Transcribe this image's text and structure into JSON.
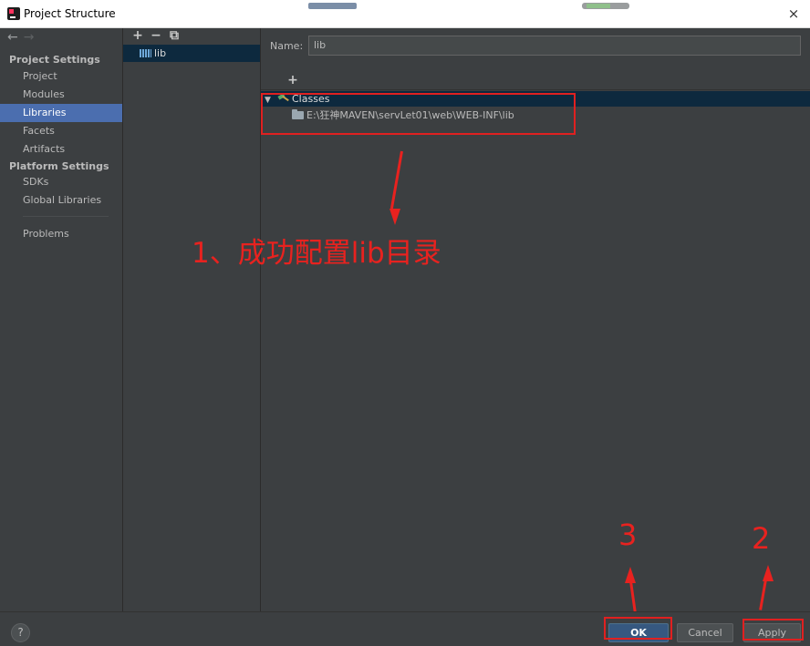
{
  "window": {
    "title": "Project Structure",
    "close_glyph": "×"
  },
  "nav": {
    "back_glyph": "←",
    "forward_glyph": "→",
    "sections": [
      {
        "label": "Project Settings",
        "items": [
          "Project",
          "Modules",
          "Libraries",
          "Facets",
          "Artifacts"
        ]
      },
      {
        "label": "Platform Settings",
        "items": [
          "SDKs",
          "Global Libraries"
        ]
      }
    ],
    "problems": "Problems",
    "selected": "Libraries"
  },
  "libraries": {
    "toolbar": {
      "add": "+",
      "remove": "−",
      "copy": "⧉"
    },
    "items": [
      "lib"
    ]
  },
  "detail": {
    "name_label": "Name:",
    "name_value": "lib",
    "toolbar": {
      "add": "+",
      "add_special": "+",
      "add_sub": "⊙",
      "add_disabled": "+",
      "remove": "−"
    },
    "tree": {
      "root": "Classes",
      "path": "E:\\狂神MAVEN\\servLet01\\web\\WEB-INF\\lib"
    }
  },
  "annotations": {
    "note1": "1、成功配置lib目录",
    "num2": "2",
    "num3": "3"
  },
  "buttons": {
    "help": "?",
    "ok": "OK",
    "cancel": "Cancel",
    "apply": "Apply"
  },
  "colors": {
    "background": "#3c3f41",
    "selection": "#4b6eaf",
    "tree_selection": "#0d293e",
    "primary_button": "#365880",
    "annotation_red": "#e8221f"
  },
  "icons": [
    "app-icon",
    "close-icon",
    "back-arrow-icon",
    "forward-arrow-icon",
    "add-icon",
    "remove-icon",
    "copy-icon",
    "library-icon",
    "expand-arrow-icon",
    "classes-hammer-icon",
    "folder-icon",
    "help-icon"
  ]
}
